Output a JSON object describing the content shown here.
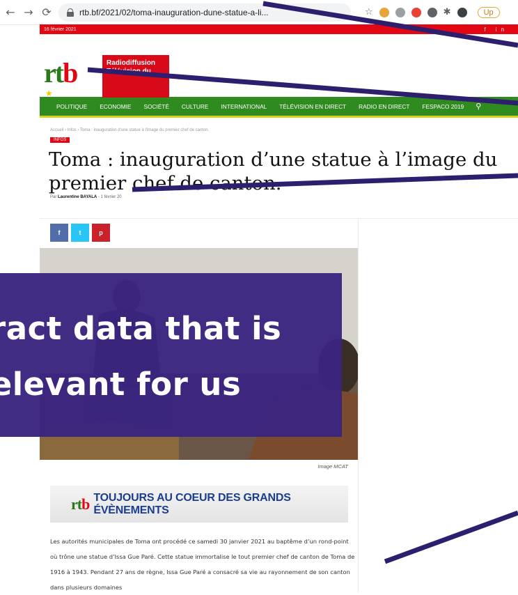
{
  "browser": {
    "back_icon": "arrow-left-icon",
    "forward_icon": "arrow-right-icon",
    "reload_icon": "reload-icon",
    "url": "rtb.bf/2021/02/toma-inauguration-dune-statue-a-li...",
    "update_label": "Up"
  },
  "site": {
    "date": "16 février 2021",
    "social_icons": "f in",
    "logo_text_r": "rt",
    "logo_text_b": "b",
    "logo_box": "Radiodiffusion\nTélévision du",
    "menu": [
      "POLITIQUE",
      "ECONOMIE",
      "SOCIÉTÉ",
      "CULTURE",
      "INTERNATIONAL",
      "TÉLÉVISION EN DIRECT",
      "RADIO EN DIRECT",
      "FESPACO 2019"
    ],
    "search_icon": "search-icon"
  },
  "article": {
    "breadcrumb": "Accueil  ›  Infos  ›  Toma : inauguration d'une statue à l'image du premier chef de canton.",
    "category": "INFOS",
    "title": "Toma : inauguration d’une statue à l’image du premier chef de canton.",
    "byline_prefix": "Par",
    "author": "Laurentine BAYALA",
    "date": "- 1 février 20",
    "share": {
      "facebook": "f",
      "twitter": "t",
      "pinterest": "p"
    },
    "image_caption": "Image MCAT",
    "promo_logo_r": "rt",
    "promo_logo_b": "b",
    "promo_text": "TOUJOURS AU COEUR DES GRANDS ÉVÈNEMENTS",
    "body": "Les autorités municipales de Toma ont procédé ce samedi 30 janvier 2021 au baptême d’un rond-point où trône une statue d’Issa Gue Paré. Cette statue immortalise le tout premier chef de canton de Toma de 1916 à 1943. Pendant 27 ans de règne, Issa Gue Paré a consacré sa vie au rayonnement de son canton dans plusieurs domaines"
  },
  "overlay": {
    "line1": "tract data that is",
    "line2": "relevant for us"
  },
  "colors": {
    "overlay": "#3a2480",
    "menu": "#2f8a1f",
    "topbar": "#e30613",
    "arrow": "#2d1f6e"
  }
}
